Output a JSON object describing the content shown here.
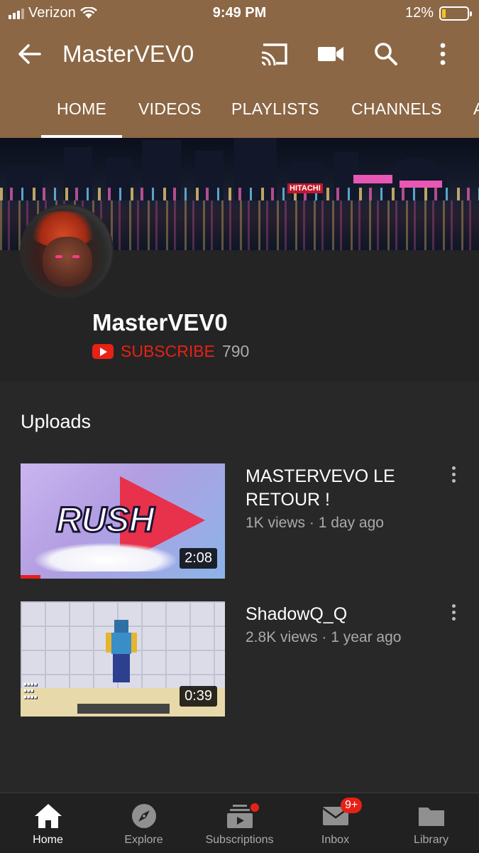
{
  "status_bar": {
    "carrier": "Verizon",
    "time": "9:49 PM",
    "battery": "12%"
  },
  "app_bar": {
    "title": "MasterVEV0"
  },
  "tabs": [
    {
      "label": "HOME"
    },
    {
      "label": "VIDEOS"
    },
    {
      "label": "PLAYLISTS"
    },
    {
      "label": "CHANNELS"
    },
    {
      "label": "A"
    }
  ],
  "banner": {
    "sign_text": "HITACHI"
  },
  "channel": {
    "name": "MasterVEV0",
    "subscribe_label": "SUBSCRIBE",
    "subscriber_count": "790"
  },
  "uploads": {
    "title": "Uploads",
    "videos": [
      {
        "title": "MASTERVEVO LE RETOUR !",
        "meta": "1K views · 1 day ago",
        "duration": "2:08",
        "thumb_text": "RUSH"
      },
      {
        "title": "ShadowQ_Q",
        "meta": "2.8K views · 1 year ago",
        "duration": "0:39"
      }
    ]
  },
  "bottom_nav": {
    "items": [
      {
        "label": "Home",
        "icon": "home-icon"
      },
      {
        "label": "Explore",
        "icon": "compass-icon"
      },
      {
        "label": "Subscriptions",
        "icon": "subscriptions-icon"
      },
      {
        "label": "Inbox",
        "icon": "inbox-icon",
        "badge": "9+"
      },
      {
        "label": "Library",
        "icon": "folder-icon"
      }
    ]
  },
  "colors": {
    "header_bg": "#8c6745",
    "youtube_red": "#e62117",
    "page_bg": "#282828"
  }
}
